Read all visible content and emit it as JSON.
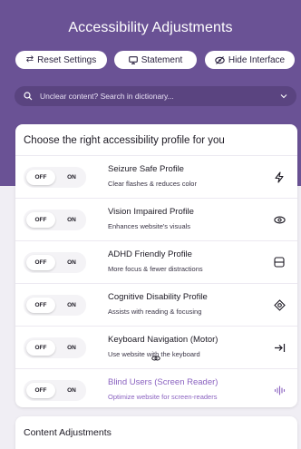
{
  "header": {
    "title": "Accessibility Adjustments",
    "actions": {
      "reset_label": "Reset Settings",
      "statement_label": "Statement",
      "hide_label": "Hide Interface"
    },
    "search": {
      "placeholder": "Unclear content? Search in dictionary..."
    }
  },
  "profiles": {
    "title": "Choose the right accessibility profile for you",
    "toggle_off": "OFF",
    "toggle_on": "ON",
    "items": [
      {
        "title": "Seizure Safe Profile",
        "desc": "Clear flashes & reduces color",
        "icon": "lightning-icon",
        "enabled": false
      },
      {
        "title": "Vision Impaired Profile",
        "desc": "Enhances website's visuals",
        "icon": "eye-icon",
        "enabled": false
      },
      {
        "title": "ADHD Friendly Profile",
        "desc": "More focus & fewer distractions",
        "icon": "focus-frame-icon",
        "enabled": false
      },
      {
        "title": "Cognitive Disability Profile",
        "desc": "Assists with reading & focusing",
        "icon": "target-icon",
        "enabled": false
      },
      {
        "title": "Keyboard Navigation (Motor)",
        "desc": "Use website with the keyboard",
        "icon": "arrow-to-bar-icon",
        "enabled": false
      },
      {
        "title": "Blind Users (Screen Reader)",
        "desc": "Optimize website for screen-readers",
        "icon": "audio-wave-icon",
        "enabled": false
      }
    ]
  },
  "content_adjustments": {
    "title": "Content Adjustments"
  },
  "colors": {
    "header_bg": "#6a5295",
    "accent_text": "#8a62c0",
    "page_bg": "#f0eef4"
  }
}
